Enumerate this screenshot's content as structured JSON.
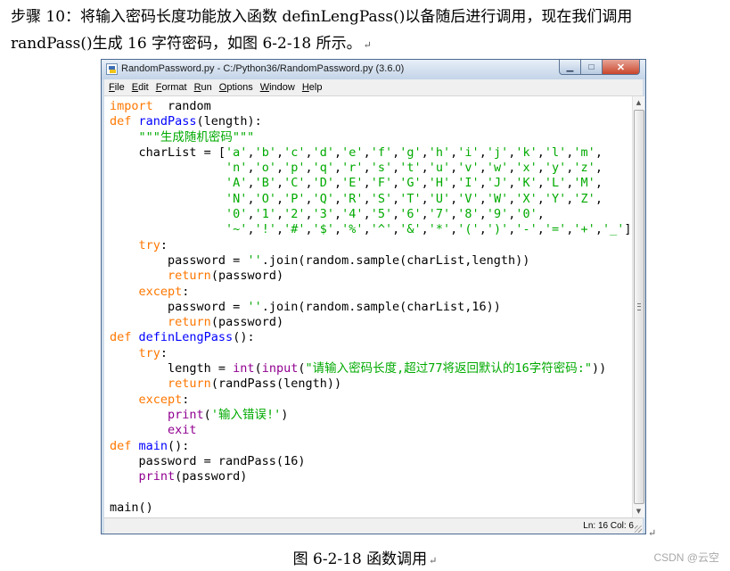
{
  "intro": {
    "line1": "步骤  10：将输入密码长度功能放入函数  definLengPass()以备随后进行调用，现在我们调用",
    "line2": "randPass()生成 16 字符密码，如图 6-2-18 所示。",
    "return_mark": "↵"
  },
  "window": {
    "title": "RandomPassword.py - C:/Python36/RandomPassword.py (3.6.0)",
    "menu": [
      "File",
      "Edit",
      "Format",
      "Run",
      "Options",
      "Window",
      "Help"
    ],
    "status": "Ln: 16  Col: 6"
  },
  "code": [
    [
      [
        "kw",
        "import"
      ],
      [
        "",
        "  random"
      ]
    ],
    [
      [
        "kw",
        "def "
      ],
      [
        "fn",
        "randPass"
      ],
      [
        "",
        "(length):"
      ]
    ],
    [
      [
        "",
        "    "
      ],
      [
        "st",
        "\"\"\"生成随机密码\"\"\""
      ]
    ],
    [
      [
        "",
        "    charList = ["
      ],
      [
        "st",
        "'a'"
      ],
      [
        "",
        ","
      ],
      [
        "st",
        "'b'"
      ],
      [
        "",
        ","
      ],
      [
        "st",
        "'c'"
      ],
      [
        "",
        ","
      ],
      [
        "st",
        "'d'"
      ],
      [
        "",
        ","
      ],
      [
        "st",
        "'e'"
      ],
      [
        "",
        ","
      ],
      [
        "st",
        "'f'"
      ],
      [
        "",
        ","
      ],
      [
        "st",
        "'g'"
      ],
      [
        "",
        ","
      ],
      [
        "st",
        "'h'"
      ],
      [
        "",
        ","
      ],
      [
        "st",
        "'i'"
      ],
      [
        "",
        ","
      ],
      [
        "st",
        "'j'"
      ],
      [
        "",
        ","
      ],
      [
        "st",
        "'k'"
      ],
      [
        "",
        ","
      ],
      [
        "st",
        "'l'"
      ],
      [
        "",
        ","
      ],
      [
        "st",
        "'m'"
      ],
      [
        "",
        ","
      ]
    ],
    [
      [
        "",
        "                "
      ],
      [
        "st",
        "'n'"
      ],
      [
        "",
        ","
      ],
      [
        "st",
        "'o'"
      ],
      [
        "",
        ","
      ],
      [
        "st",
        "'p'"
      ],
      [
        "",
        ","
      ],
      [
        "st",
        "'q'"
      ],
      [
        "",
        ","
      ],
      [
        "st",
        "'r'"
      ],
      [
        "",
        ","
      ],
      [
        "st",
        "'s'"
      ],
      [
        "",
        ","
      ],
      [
        "st",
        "'t'"
      ],
      [
        "",
        ","
      ],
      [
        "st",
        "'u'"
      ],
      [
        "",
        ","
      ],
      [
        "st",
        "'v'"
      ],
      [
        "",
        ","
      ],
      [
        "st",
        "'w'"
      ],
      [
        "",
        ","
      ],
      [
        "st",
        "'x'"
      ],
      [
        "",
        ","
      ],
      [
        "st",
        "'y'"
      ],
      [
        "",
        ","
      ],
      [
        "st",
        "'z'"
      ],
      [
        "",
        ","
      ]
    ],
    [
      [
        "",
        "                "
      ],
      [
        "st",
        "'A'"
      ],
      [
        "",
        ","
      ],
      [
        "st",
        "'B'"
      ],
      [
        "",
        ","
      ],
      [
        "st",
        "'C'"
      ],
      [
        "",
        ","
      ],
      [
        "st",
        "'D'"
      ],
      [
        "",
        ","
      ],
      [
        "st",
        "'E'"
      ],
      [
        "",
        ","
      ],
      [
        "st",
        "'F'"
      ],
      [
        "",
        ","
      ],
      [
        "st",
        "'G'"
      ],
      [
        "",
        ","
      ],
      [
        "st",
        "'H'"
      ],
      [
        "",
        ","
      ],
      [
        "st",
        "'I'"
      ],
      [
        "",
        ","
      ],
      [
        "st",
        "'J'"
      ],
      [
        "",
        ","
      ],
      [
        "st",
        "'K'"
      ],
      [
        "",
        ","
      ],
      [
        "st",
        "'L'"
      ],
      [
        "",
        ","
      ],
      [
        "st",
        "'M'"
      ],
      [
        "",
        ","
      ]
    ],
    [
      [
        "",
        "                "
      ],
      [
        "st",
        "'N'"
      ],
      [
        "",
        ","
      ],
      [
        "st",
        "'O'"
      ],
      [
        "",
        ","
      ],
      [
        "st",
        "'P'"
      ],
      [
        "",
        ","
      ],
      [
        "st",
        "'Q'"
      ],
      [
        "",
        ","
      ],
      [
        "st",
        "'R'"
      ],
      [
        "",
        ","
      ],
      [
        "st",
        "'S'"
      ],
      [
        "",
        ","
      ],
      [
        "st",
        "'T'"
      ],
      [
        "",
        ","
      ],
      [
        "st",
        "'U'"
      ],
      [
        "",
        ","
      ],
      [
        "st",
        "'V'"
      ],
      [
        "",
        ","
      ],
      [
        "st",
        "'W'"
      ],
      [
        "",
        ","
      ],
      [
        "st",
        "'X'"
      ],
      [
        "",
        ","
      ],
      [
        "st",
        "'Y'"
      ],
      [
        "",
        ","
      ],
      [
        "st",
        "'Z'"
      ],
      [
        "",
        ","
      ]
    ],
    [
      [
        "",
        "                "
      ],
      [
        "st",
        "'0'"
      ],
      [
        "",
        ","
      ],
      [
        "st",
        "'1'"
      ],
      [
        "",
        ","
      ],
      [
        "st",
        "'2'"
      ],
      [
        "",
        ","
      ],
      [
        "st",
        "'3'"
      ],
      [
        "",
        ","
      ],
      [
        "st",
        "'4'"
      ],
      [
        "",
        ","
      ],
      [
        "st",
        "'5'"
      ],
      [
        "",
        ","
      ],
      [
        "st",
        "'6'"
      ],
      [
        "",
        ","
      ],
      [
        "st",
        "'7'"
      ],
      [
        "",
        ","
      ],
      [
        "st",
        "'8'"
      ],
      [
        "",
        ","
      ],
      [
        "st",
        "'9'"
      ],
      [
        "",
        ","
      ],
      [
        "st",
        "'0'"
      ],
      [
        "",
        ","
      ]
    ],
    [
      [
        "",
        "                "
      ],
      [
        "st",
        "'~'"
      ],
      [
        "",
        ","
      ],
      [
        "st",
        "'!'"
      ],
      [
        "",
        ","
      ],
      [
        "st",
        "'#'"
      ],
      [
        "",
        ","
      ],
      [
        "st",
        "'$'"
      ],
      [
        "",
        ","
      ],
      [
        "st",
        "'%'"
      ],
      [
        "",
        ","
      ],
      [
        "st",
        "'^'"
      ],
      [
        "",
        ","
      ],
      [
        "st",
        "'&'"
      ],
      [
        "",
        ","
      ],
      [
        "st",
        "'*'"
      ],
      [
        "",
        ","
      ],
      [
        "st",
        "'('"
      ],
      [
        "",
        ","
      ],
      [
        "st",
        "')'"
      ],
      [
        "",
        ","
      ],
      [
        "st",
        "'-'"
      ],
      [
        "",
        ","
      ],
      [
        "st",
        "'='"
      ],
      [
        "",
        ","
      ],
      [
        "st",
        "'+'"
      ],
      [
        "",
        ","
      ],
      [
        "st",
        "'_'"
      ],
      [
        "",
        "]"
      ]
    ],
    [
      [
        "",
        "    "
      ],
      [
        "kw",
        "try"
      ],
      [
        "",
        ":"
      ]
    ],
    [
      [
        "",
        "        password = "
      ],
      [
        "st",
        "''"
      ],
      [
        "",
        ".join(random.sample(charList,length))"
      ]
    ],
    [
      [
        "",
        "        "
      ],
      [
        "kw",
        "return"
      ],
      [
        "",
        "(password)"
      ]
    ],
    [
      [
        "",
        "    "
      ],
      [
        "kw",
        "except"
      ],
      [
        "",
        ":"
      ]
    ],
    [
      [
        "",
        "        password = "
      ],
      [
        "st",
        "''"
      ],
      [
        "",
        ".join(random.sample(charList,16))"
      ]
    ],
    [
      [
        "",
        "        "
      ],
      [
        "kw",
        "return"
      ],
      [
        "",
        "(password)"
      ]
    ],
    [
      [
        "kw",
        "def "
      ],
      [
        "fn",
        "definLengPass"
      ],
      [
        "",
        "():"
      ]
    ],
    [
      [
        "",
        "    "
      ],
      [
        "kw",
        "try"
      ],
      [
        "",
        ":"
      ]
    ],
    [
      [
        "",
        "        length = "
      ],
      [
        "bi",
        "int"
      ],
      [
        "",
        "("
      ],
      [
        "bi",
        "input"
      ],
      [
        "",
        "("
      ],
      [
        "st",
        "\"请输入密码长度,超过77将返回默认的16字符密码:\""
      ],
      [
        "",
        "))"
      ]
    ],
    [
      [
        "",
        "        "
      ],
      [
        "kw",
        "return"
      ],
      [
        "",
        "(randPass(length))"
      ]
    ],
    [
      [
        "",
        "    "
      ],
      [
        "kw",
        "except"
      ],
      [
        "",
        ":"
      ]
    ],
    [
      [
        "",
        "        "
      ],
      [
        "bi",
        "print"
      ],
      [
        "",
        "("
      ],
      [
        "st",
        "'输入错误!'"
      ],
      [
        "",
        ")"
      ]
    ],
    [
      [
        "",
        "        "
      ],
      [
        "bi",
        "exit"
      ]
    ],
    [
      [
        "kw",
        "def "
      ],
      [
        "fn",
        "main"
      ],
      [
        "",
        "():"
      ]
    ],
    [
      [
        "",
        "    password = randPass(16)"
      ]
    ],
    [
      [
        "",
        "    "
      ],
      [
        "bi",
        "print"
      ],
      [
        "",
        "(password)"
      ]
    ],
    [
      [
        "",
        ""
      ]
    ],
    [
      [
        "",
        "main()"
      ]
    ]
  ],
  "caption": "图 6-2-18  函数调用",
  "watermark": "CSDN @云空",
  "colors": {
    "keyword": "#ff7700",
    "function_def": "#0000ff",
    "builtin": "#900090",
    "string": "#00aa00"
  }
}
